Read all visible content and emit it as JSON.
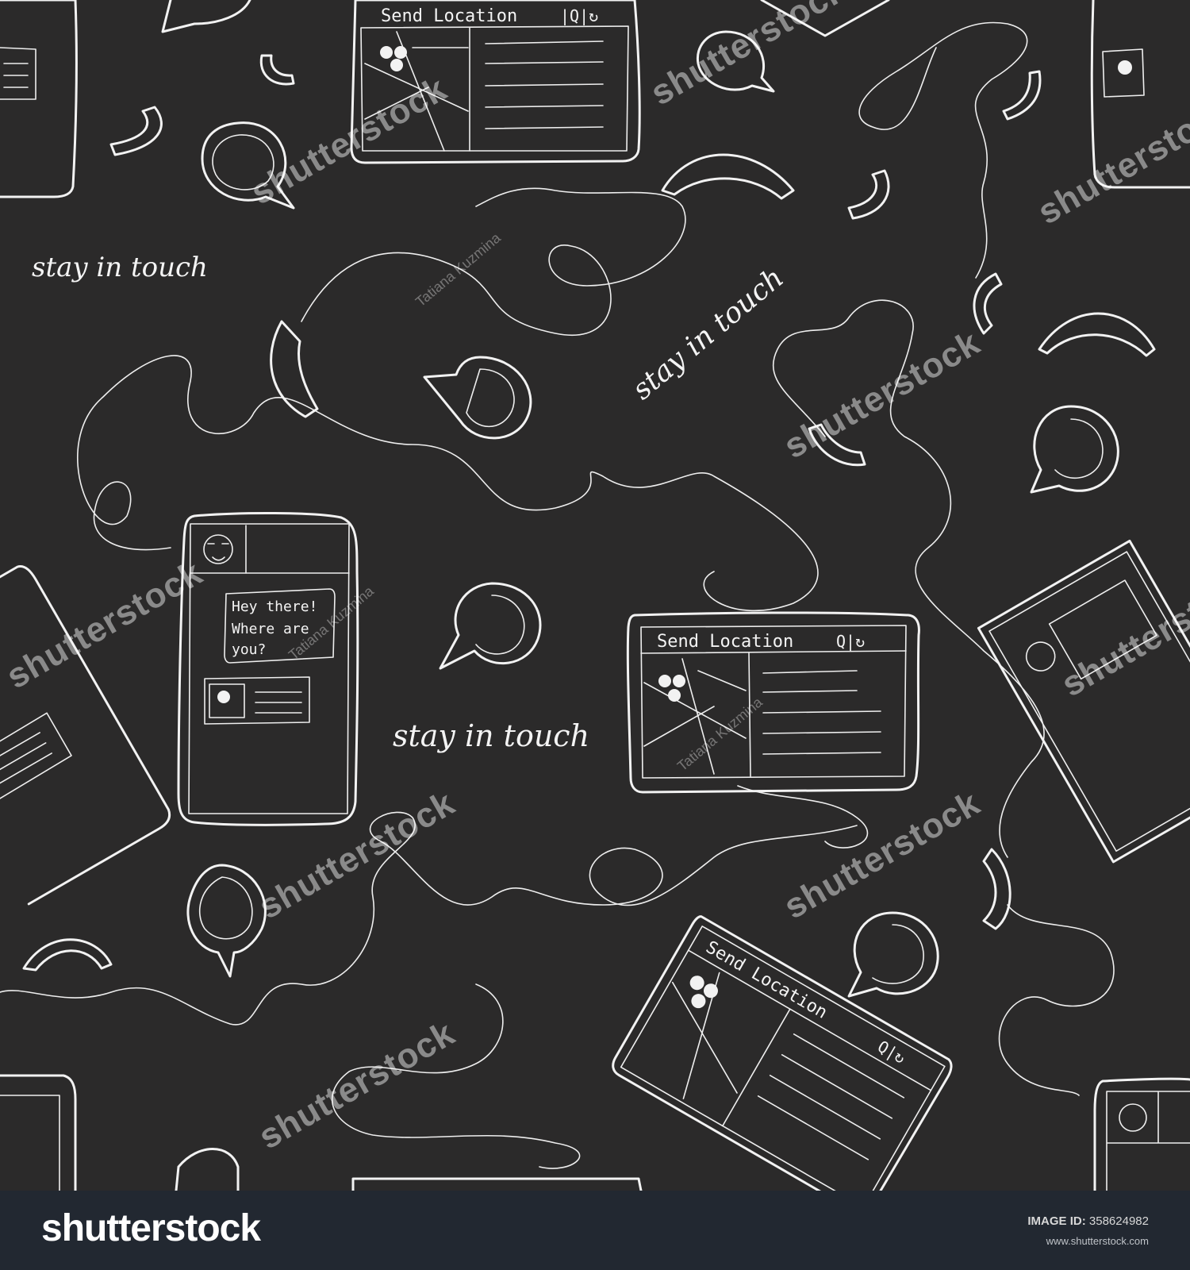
{
  "pattern": {
    "slogan": "stay in touch",
    "send_location_title": "Send Location",
    "chat_message": [
      "Hey there!",
      "Where are",
      "you?"
    ],
    "colors": {
      "background": "#2b2a2a",
      "line": "#f2f2f2"
    }
  },
  "watermarks": {
    "brand": "shutterstock",
    "author": "Tatiana Kuzmina"
  },
  "footer": {
    "logo": "shutterstock",
    "image_id_label": "IMAGE ID:",
    "image_id": "358624982",
    "url": "www.shutterstock.com"
  }
}
